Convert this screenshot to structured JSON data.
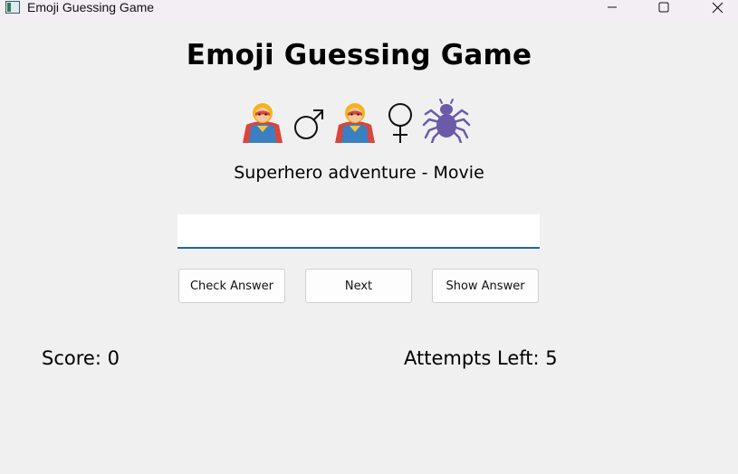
{
  "window": {
    "title": "Emoji Guessing Game",
    "icons": [
      "app-icon",
      "minimize-icon",
      "maximize-icon",
      "close-icon"
    ]
  },
  "game": {
    "title": "Emoji Guessing Game",
    "emojis": [
      "superhero-icon",
      "male-sign-icon",
      "superhero-icon",
      "female-sign-icon",
      "spider-icon"
    ],
    "clue": "Superhero adventure - Movie",
    "answer_value": "",
    "check_label": "Check Answer",
    "next_label": "Next",
    "show_label": "Show Answer",
    "score_text": "Score: 0",
    "attempts_text": "Attempts Left: 5"
  },
  "colors": {
    "background": "#f0f0f0",
    "titlebar": "#f3eef3",
    "input_underline": "#1c64b4",
    "spider": "#6a5aa8",
    "hero_suit": "#3a7fc2",
    "hero_cape": "#d9463a",
    "hero_hair": "#f6b21c"
  }
}
